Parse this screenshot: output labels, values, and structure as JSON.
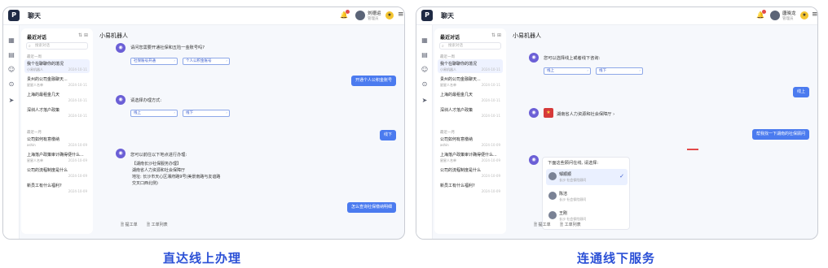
{
  "left": {
    "logo": "P",
    "app_title": "聊天",
    "user_name": "刘德运",
    "user_role": "管理员",
    "list_title": "最近对话",
    "search_placeholder": "搜索对话",
    "group1": "最近一周",
    "group2": "最近一月",
    "conversations": [
      {
        "title": "我个在聊聊你的境况",
        "sub": "小易机器人",
        "date": "2024-10-11"
      },
      {
        "title": "贵州的公司金融聊天...",
        "sub": "星星人名单",
        "date": "2024-10-11"
      },
      {
        "title": "上海的最租金几天",
        "sub": "",
        "date": "2024-10-11"
      },
      {
        "title": "深圳人才落户政策",
        "sub": "",
        "date": "2024-10-11"
      },
      {
        "title": "公司如何有意缴纳",
        "sub": "ashin",
        "date": "2024-10-09"
      },
      {
        "title": "上海落户政策审计确得便什么...",
        "sub": "星星人名单",
        "date": "2024-10-09"
      },
      {
        "title": "公司的流程制度是什么",
        "sub": "",
        "date": "2024-10-09"
      },
      {
        "title": "新员工有什么福利?",
        "sub": "",
        "date": "2024-10-09"
      }
    ],
    "chat_title": "小易机器人",
    "q1": "请问您需要开通社保和五险一金账号吗?",
    "q1_opt1": "社保账号开通",
    "q1_opt2": "个人公积金账号",
    "a1": "开通个人公积金账号",
    "q2": "请选择办理方式:",
    "q2_opt1": "线上",
    "q2_opt2": "线下",
    "a2": "线下",
    "q3": "您可以前往以下地点进行办理:",
    "card_line1": "【湖南长沙社保服务办理】",
    "card_line2": "湖南省人力资源和社会保障厅",
    "card_line3": "地址: 长沙市天心区湘府路9号(美景南路与友谊路",
    "card_line4": "交叉口西北侧)",
    "a3": "怎么查询社保缴纳明细",
    "footer1": "提工单",
    "footer2": "工单列表",
    "caption": "直达线上办理"
  },
  "right": {
    "logo": "P",
    "app_title": "聊天",
    "user_name": "唐晓龙",
    "user_role": "管理员",
    "list_title": "最近对话",
    "search_placeholder": "搜索对话",
    "group1": "最近一周",
    "group2": "最近一月",
    "conversations": [
      {
        "title": "我个在聊聊你的境况",
        "sub": "小易机器人",
        "date": "2024-10-11"
      },
      {
        "title": "贵州的公司金融聊天...",
        "sub": "星星人名单",
        "date": "2024-10-11"
      },
      {
        "title": "上海的最租金几天",
        "sub": "",
        "date": "2024-10-11"
      },
      {
        "title": "深圳人才落户政策",
        "sub": "",
        "date": "2024-10-11"
      },
      {
        "title": "公司如何有意缴纳",
        "sub": "ashin",
        "date": "2024-10-09"
      },
      {
        "title": "上海落户政策审计确得便什么...",
        "sub": "星星人名单",
        "date": "2024-10-09"
      },
      {
        "title": "公司的流程制度是什么",
        "sub": "",
        "date": "2024-10-09"
      },
      {
        "title": "新员工有什么福利?",
        "sub": "",
        "date": "2024-10-09"
      }
    ],
    "chat_title": "小易机器人",
    "q1": "您可以选择线上或者线下咨询:",
    "q1_opt1": "线上",
    "q1_opt2": "线下",
    "a1": "线上",
    "inst_name": "湖南省人力资源和社会保障厅",
    "a2": "帮我找一下湖南的社保顾问",
    "q3": "下面这些顾问在线, 请选择:",
    "people": [
      {
        "name": "邹顺顺",
        "desc": "长沙 社会保险顾问"
      },
      {
        "name": "陈洁",
        "desc": "长沙 社会保险顾问"
      },
      {
        "name": "王刚",
        "desc": "长沙 社会保险顾问"
      }
    ],
    "footer1": "提工单",
    "footer2": "工单列表",
    "caption": "连通线下服务"
  },
  "colors": {
    "accent": "#4b7bef",
    "caption": "#2b50d6",
    "bot": "#6b5fd6"
  }
}
